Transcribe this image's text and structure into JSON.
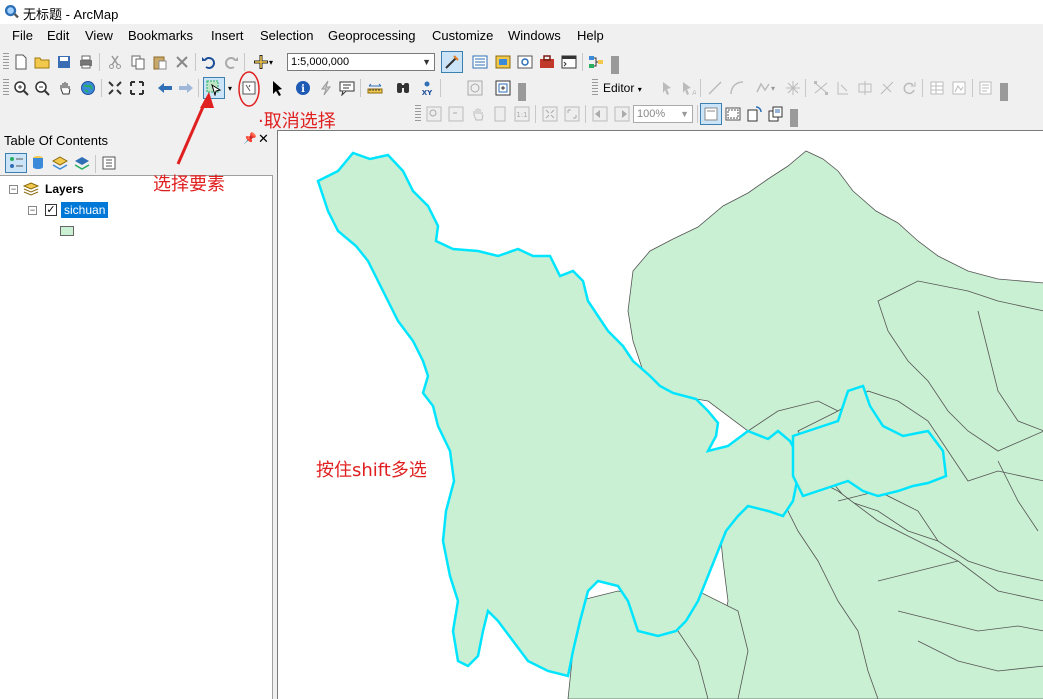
{
  "window": {
    "title": "无标题 - ArcMap"
  },
  "menu": [
    "File",
    "Edit",
    "View",
    "Bookmarks",
    "Insert",
    "Selection",
    "Geoprocessing",
    "Customize",
    "Windows",
    "Help"
  ],
  "toolbar": {
    "scale_value": "1:5,000,000",
    "zoom_value": "100%",
    "editor_label": "Editor"
  },
  "toc": {
    "title": "Table Of Contents",
    "root_label": "Layers",
    "layer_name": "sichuan"
  },
  "annotations": {
    "select_features": "选择要素",
    "clear_selection": "·取消选择",
    "shift_multi": "按住shift多选"
  },
  "colors": {
    "feature_fill": "#c9f0d2",
    "selection_outline": "#00e5ff",
    "annotation_red": "#e02020",
    "toc_selected": "#0078d7"
  },
  "icons": [
    "arcmap-logo-icon",
    "new-doc-icon",
    "open-icon",
    "save-icon",
    "print-icon",
    "cut-icon",
    "copy-icon",
    "paste-icon",
    "delete-icon",
    "undo-icon",
    "redo-icon",
    "add-data-icon",
    "editor-toolbar-icon",
    "toc-icon",
    "catalog-icon",
    "search-icon",
    "arctoolbox-icon",
    "python-icon",
    "model-builder-icon",
    "zoom-in-icon",
    "zoom-out-icon",
    "pan-icon",
    "full-extent-icon",
    "fixed-zoom-in-icon",
    "fixed-zoom-out-icon",
    "back-icon",
    "forward-icon",
    "select-features-icon",
    "clear-selection-icon",
    "select-elements-icon",
    "identify-icon",
    "hyperlink-icon",
    "html-popup-icon",
    "measure-icon",
    "find-icon",
    "go-to-xy-icon",
    "time-slider-icon",
    "create-viewer-icon"
  ]
}
